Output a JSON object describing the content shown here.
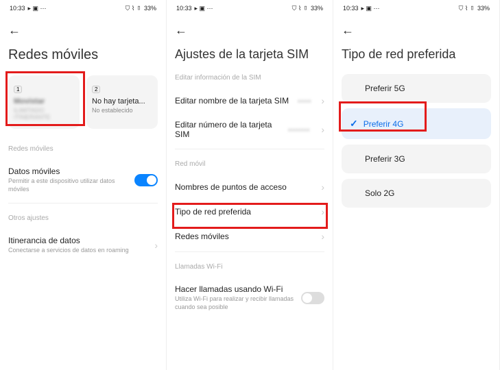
{
  "status": {
    "time": "10:33",
    "battery": "33%"
  },
  "screen1": {
    "title": "Redes móviles",
    "sim1": {
      "num": "1",
      "name": "Movistar",
      "sub": "ILIMITADO ITINERANTE"
    },
    "sim2": {
      "num": "2",
      "name": "No hay tarjeta...",
      "sub": "No establecido"
    },
    "sec1": "Redes móviles",
    "row1_title": "Datos móviles",
    "row1_sub": "Permitir a este dispositivo utilizar datos móviles",
    "sec2": "Otros ajustes",
    "row2_title": "Itinerancia de datos",
    "row2_sub": "Conectarse a servicios de datos en roaming"
  },
  "screen2": {
    "title": "Ajustes de la tarjeta SIM",
    "sec1": "Editar información de la SIM",
    "r1": "Editar nombre de la tarjeta SIM",
    "r2": "Editar número de la tarjeta SIM",
    "sec2": "Red móvil",
    "r3": "Nombres de puntos de acceso",
    "r4": "Tipo de red preferida",
    "r5": "Redes móviles",
    "sec3": "Llamadas Wi-Fi",
    "r6_title": "Hacer llamadas usando Wi-Fi",
    "r6_sub": "Utiliza Wi-Fi para realizar y recibir llamadas cuando sea posible"
  },
  "screen3": {
    "title": "Tipo de red preferida",
    "opts": [
      "Preferir 5G",
      "Preferir 4G",
      "Preferir 3G",
      "Solo 2G"
    ]
  }
}
